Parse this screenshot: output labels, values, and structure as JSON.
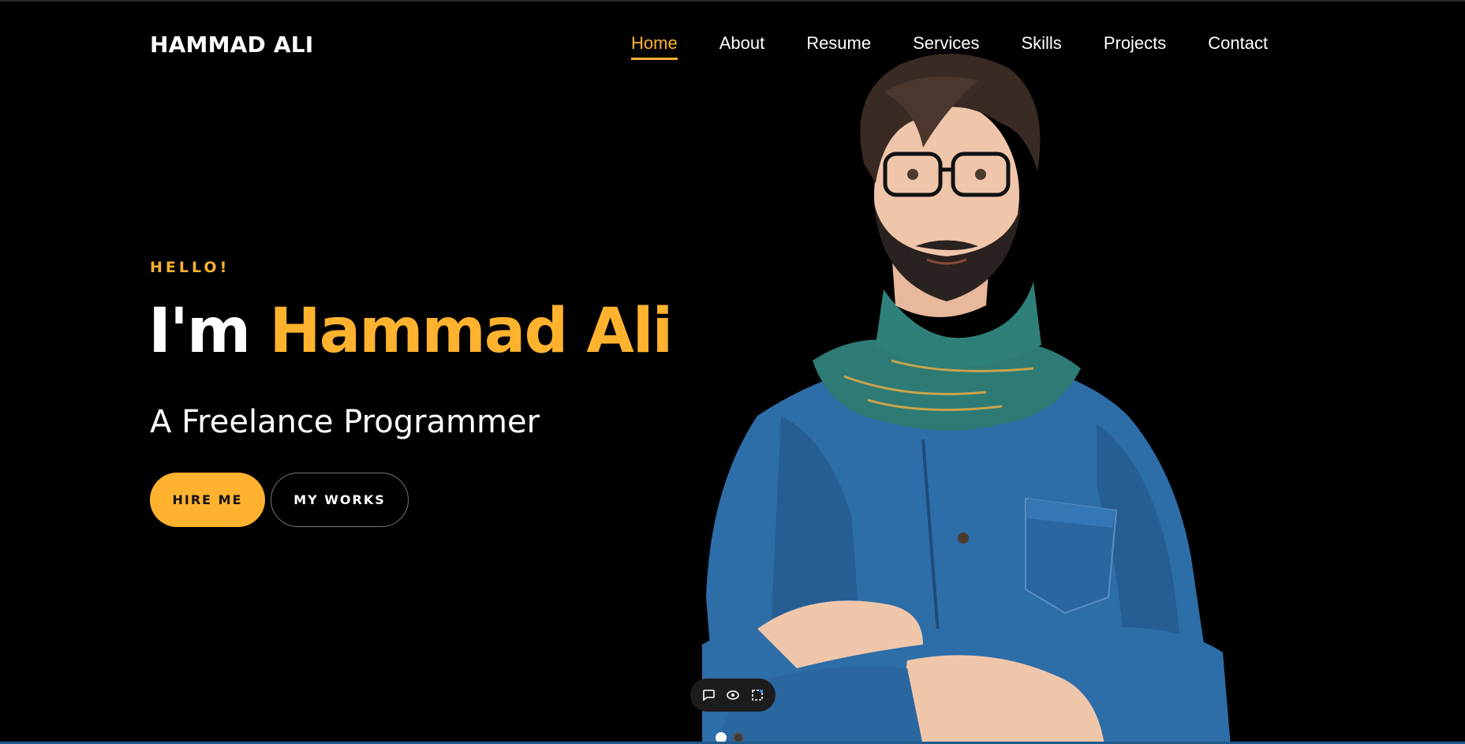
{
  "brand": {
    "name": "HAMMAD ALI"
  },
  "nav": {
    "items": [
      {
        "label": "Home",
        "active": true
      },
      {
        "label": "About"
      },
      {
        "label": "Resume"
      },
      {
        "label": "Services"
      },
      {
        "label": "Skills"
      },
      {
        "label": "Projects"
      },
      {
        "label": "Contact"
      }
    ]
  },
  "hero": {
    "greeting": "HELLO!",
    "headline_prefix": "I'm",
    "headline_name": "Hammad Ali",
    "subtitle": "A Freelance Programmer",
    "hire_label": "HIRE ME",
    "works_label": "MY WORKS"
  },
  "toolbar": {
    "icons": [
      "comment-icon",
      "eye-icon",
      "layout-icon"
    ]
  },
  "slider": {
    "count": 2,
    "active_index": 0
  },
  "colors": {
    "accent": "#ffb22e",
    "background": "#000000",
    "text": "#ffffff"
  }
}
